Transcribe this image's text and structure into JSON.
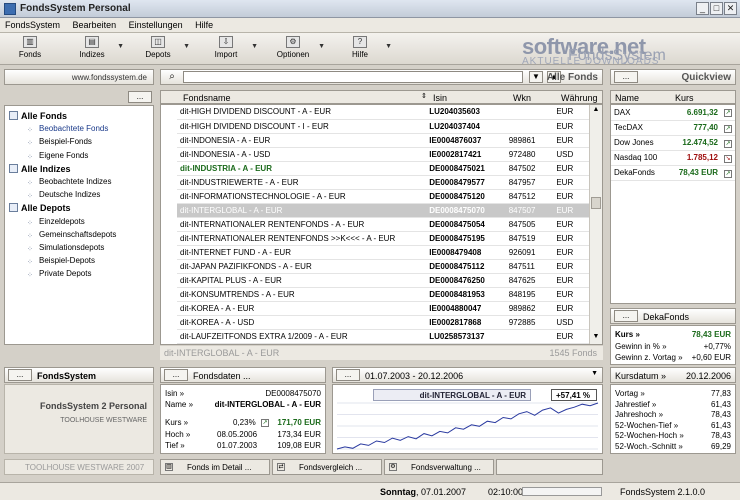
{
  "window": {
    "title": "FondsSystem Personal",
    "minimize": "_",
    "maximize": "□",
    "close": "✕"
  },
  "menu": [
    "FondsSystem",
    "Bearbeiten",
    "Einstellungen",
    "Hilfe"
  ],
  "toolbar": [
    {
      "label": "Fonds",
      "icon": "fonds-icon"
    },
    {
      "label": "Indizes",
      "icon": "indices-icon"
    },
    {
      "label": "Depots",
      "icon": "depots-icon"
    },
    {
      "label": "Import",
      "icon": "import-icon"
    },
    {
      "label": "Optionen",
      "icon": "options-icon"
    },
    {
      "label": "Hilfe",
      "icon": "help-icon"
    }
  ],
  "watermark": {
    "line1": "software.net",
    "line2": "FondsSystem",
    "line3": "AKTUELLE DOWNLOADS"
  },
  "left": {
    "url": "www.fondssystem.de",
    "menu_btn": "...",
    "tree": [
      {
        "label": "Alle Fonds",
        "bold": true,
        "indent": 0
      },
      {
        "label": "Beobachtete Fonds",
        "link": true,
        "indent": 1
      },
      {
        "label": "Beispiel-Fonds",
        "indent": 1
      },
      {
        "label": "Eigene Fonds",
        "indent": 1
      },
      {
        "label": "Alle Indizes",
        "bold": true,
        "indent": 0
      },
      {
        "label": "Beobachtete Indizes",
        "indent": 1
      },
      {
        "label": "Deutsche Indizes",
        "indent": 1
      },
      {
        "label": "Alle Depots",
        "bold": true,
        "indent": 0
      },
      {
        "label": "Einzeldepots",
        "indent": 1
      },
      {
        "label": "Gemeinschaftsdepots",
        "indent": 1
      },
      {
        "label": "Simulationsdepots",
        "indent": 1
      },
      {
        "label": "Beispiel-Depots",
        "indent": 1
      },
      {
        "label": "Private Depots",
        "indent": 1
      }
    ]
  },
  "center": {
    "heading": "Alle Fonds",
    "columns": [
      "Fondsname",
      "Isin",
      "Wkn",
      "Währung"
    ],
    "rows": [
      [
        "dit-HIGH DIVIDEND DISCOUNT - A - EUR",
        "LU204035603",
        "",
        "EUR"
      ],
      [
        "dit-HIGH DIVIDEND DISCOUNT - I - EUR",
        "LU204037404",
        "",
        "EUR"
      ],
      [
        "dit-INDONESIA - A - EUR",
        "IE0004876037",
        "989861",
        "EUR"
      ],
      [
        "dit-INDONESIA - A - USD",
        "IE0002817421",
        "972480",
        "USD"
      ],
      [
        "dit-INDUSTRIA - A - EUR",
        "DE0008475021",
        "847502",
        "EUR"
      ],
      [
        "dit-INDUSTRIEWERTE - A - EUR",
        "DE0008479577",
        "847957",
        "EUR"
      ],
      [
        "dit-INFORMATIONSTECHNOLOGIE - A - EUR",
        "DE0008475120",
        "847512",
        "EUR"
      ],
      [
        "dit-INTERGLOBAL - A - EUR",
        "DE0008475070",
        "847507",
        "EUR"
      ],
      [
        "dit-INTERNATIONALER RENTENFONDS - A - EUR",
        "DE0008475054",
        "847505",
        "EUR"
      ],
      [
        "dit-INTERNATIONALER RENTENFONDS >>K<<< - A - EUR",
        "DE0008475195",
        "847519",
        "EUR"
      ],
      [
        "dit-INTERNET FUND - A - EUR",
        "IE0008479408",
        "926091",
        "EUR"
      ],
      [
        "dit-JAPAN PAZIFIKFONDS - A - EUR",
        "DE0008475112",
        "847511",
        "EUR"
      ],
      [
        "dit-KAPITAL PLUS - A - EUR",
        "DE0008476250",
        "847625",
        "EUR"
      ],
      [
        "dit-KONSUMTRENDS - A - EUR",
        "DE0008481953",
        "848195",
        "EUR"
      ],
      [
        "dit-KOREA - A - EUR",
        "IE0004880047",
        "989862",
        "EUR"
      ],
      [
        "dit-KOREA - A - USD",
        "IE0002817868",
        "972885",
        "USD"
      ],
      [
        "dit-LAUFZEITFONDS EXTRA 1/2009 - A - EUR",
        "LU0258573137",
        "",
        "EUR"
      ]
    ],
    "selected_row": 7,
    "highlight_row": 4,
    "footer_left": "dit-INTERGLOBAL - A - EUR",
    "footer_right": "1545 Fonds"
  },
  "quickview": {
    "heading": "Quickview",
    "menu_btn": "...",
    "columns": [
      "Name",
      "Kurs"
    ],
    "rows": [
      {
        "name": "DAX",
        "value": "6.691,32",
        "trend": "up"
      },
      {
        "name": "TecDAX",
        "value": "777,40",
        "trend": "up"
      },
      {
        "name": "Dow Jones",
        "value": "12.474,52",
        "trend": "up"
      },
      {
        "name": "Nasdaq 100",
        "value": "1.785,12",
        "trend": "down"
      },
      {
        "name": "DekaFonds",
        "value": "78,43 EUR",
        "trend": "up"
      }
    ],
    "detail_title": "DekaFonds",
    "detail_btn": "...",
    "kurs_label": "Kurs »",
    "kurs_value": "78,43 EUR",
    "gewinn_label": "Gewinn in % »",
    "gewinn_value": "+0,77%",
    "gewinn2_label": "Gewinn z. Vortag »",
    "gewinn2_value": "+0,60 EUR",
    "kursdatum_label": "Kursdatum »",
    "kursdatum_value": "20.12.2006",
    "stats": [
      [
        "Vortag »",
        "77,83"
      ],
      [
        "Jahrestief »",
        "61,43"
      ],
      [
        "Jahreshoch »",
        "78,43"
      ],
      [
        "52-Wochen-Tief »",
        "61,43"
      ],
      [
        "52-Wochen-Hoch »",
        "78,43"
      ],
      [
        "52-Woch.-Schnitt »",
        "69,29"
      ]
    ]
  },
  "bottom_left": {
    "menu_btn": "...",
    "heading": "FondsSystem",
    "product": "FondsSystem 2 Personal",
    "company": "TOOLHOUSE WESTWARE",
    "footer": "TOOLHOUSE WESTWARE 2007"
  },
  "fondsdaten": {
    "menu_btn": "...",
    "heading": "Fondsdaten ...",
    "isin_label": "Isin »",
    "isin_value": "DE0008475070",
    "name_label": "Name »",
    "name_value": "dit-INTERGLOBAL - A - EUR",
    "kurs_label": "Kurs »",
    "kurs_pct": "0,23%",
    "kurs_value": "171,70 EUR",
    "hoch_label": "Hoch »",
    "hoch_date": "08.05.2006",
    "hoch_value": "173,34 EUR",
    "tief_label": "Tief »",
    "tief_date": "01.07.2003",
    "tief_value": "109,08 EUR"
  },
  "chart": {
    "menu_btn": "...",
    "range": "01.07.2003 - 20.12.2006",
    "name": "dit-INTERGLOBAL - A - EUR",
    "gain": "+57,41 %"
  },
  "chart_data": {
    "type": "line",
    "x_range": [
      "01.07.2003",
      "20.12.2006"
    ],
    "series": [
      {
        "values": [
          109.1,
          112,
          110,
          116,
          114,
          120,
          118,
          124,
          121,
          126,
          123,
          130,
          127,
          133,
          131,
          138,
          136,
          142,
          140,
          147,
          145,
          152,
          150,
          157,
          160,
          155,
          162,
          165,
          158,
          163,
          166,
          170,
          168,
          171.7
        ]
      }
    ]
  },
  "bottom_buttons": [
    {
      "label": "Fonds im Detail ..."
    },
    {
      "label": "Fondsvergleich ..."
    },
    {
      "label": "Fondsverwaltung ..."
    }
  ],
  "status": {
    "day": "Sonntag",
    "date": "07.01.2007",
    "time": "02:10:00",
    "version": "FondsSystem 2.1.0.0"
  }
}
